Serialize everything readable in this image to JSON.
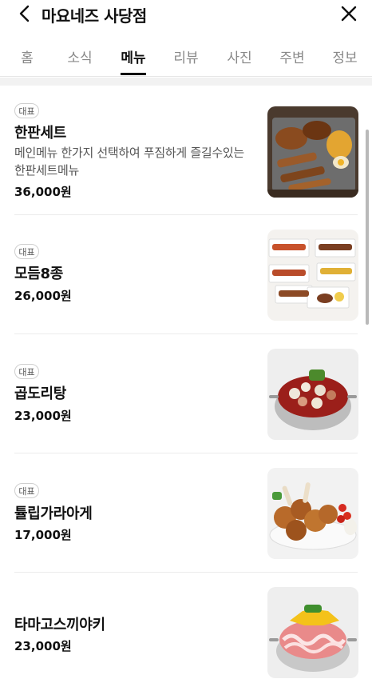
{
  "header": {
    "title": "마요네즈 사당점"
  },
  "tabs": [
    {
      "label": "홈"
    },
    {
      "label": "소식"
    },
    {
      "label": "메뉴"
    },
    {
      "label": "리뷰"
    },
    {
      "label": "사진"
    },
    {
      "label": "주변"
    },
    {
      "label": "정보"
    }
  ],
  "active_tab": "메뉴",
  "menu": [
    {
      "badge": "대표",
      "name": "한판세트",
      "desc": "메인메뉴 한가지 선택하여 푸짐하게 즐길수있는 한판세트메뉴",
      "price": "36,000원"
    },
    {
      "badge": "대표",
      "name": "모듬8종",
      "price": "26,000원"
    },
    {
      "badge": "대표",
      "name": "곱도리탕",
      "price": "23,000원"
    },
    {
      "badge": "대표",
      "name": "튤립가라아게",
      "price": "17,000원"
    },
    {
      "name": "타마고스끼야키",
      "price": "23,000원"
    }
  ],
  "colors": {
    "active_tab": "#111111",
    "inactive_tab": "#888888",
    "divider": "#ececec",
    "badge_border": "#cfcfcf"
  }
}
